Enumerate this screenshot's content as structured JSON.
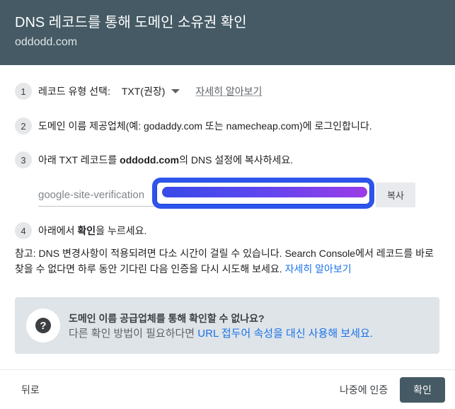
{
  "header": {
    "title": "DNS 레코드를 통해 도메인 소유권 확인",
    "domain": "oddodd.com"
  },
  "steps": [
    {
      "num": "1",
      "label": "레코드 유형 선택:",
      "select_value": "TXT(권장)",
      "link": "자세히 알아보기"
    },
    {
      "num": "2",
      "text": "도메인 이름 제공업체(예: godaddy.com 또는 namecheap.com)에 로그인합니다."
    },
    {
      "num": "3",
      "text_before": "아래 TXT 레코드를 ",
      "bold": "oddodd.com",
      "text_after": "의 DNS 설정에 복사하세요."
    },
    {
      "num": "4",
      "text_before": "아래에서 ",
      "bold": "확인",
      "text_after": "을 누르세요."
    }
  ],
  "verification": {
    "prefix": "google-site-verification",
    "copy_label": "복사"
  },
  "note": {
    "text": "참고: DNS 변경사항이 적용되려면 다소 시간이 걸릴 수 있습니다. Search Console에서 레코드를 바로 찾을 수 없다면 하루 동안 기다린 다음 인증을 다시 시도해 보세요. ",
    "link": "자세히 알아보기"
  },
  "info_box": {
    "icon": "help-icon",
    "icon_glyph": "?",
    "title": "도메인 이름 공급업체를 통해 확인할 수 없나요?",
    "sub_text": "다른 확인 방법이 필요하다면 ",
    "sub_link": "URL 접두어 속성을 대신 사용해 보세요."
  },
  "footer": {
    "back_label": "뒤로",
    "later_label": "나중에 인증",
    "confirm_label": "확인"
  },
  "colors": {
    "header_bg": "#455a64",
    "link": "#1a73e8",
    "highlight_border": "#2d55ec",
    "confirm_bg": "#455a64"
  }
}
